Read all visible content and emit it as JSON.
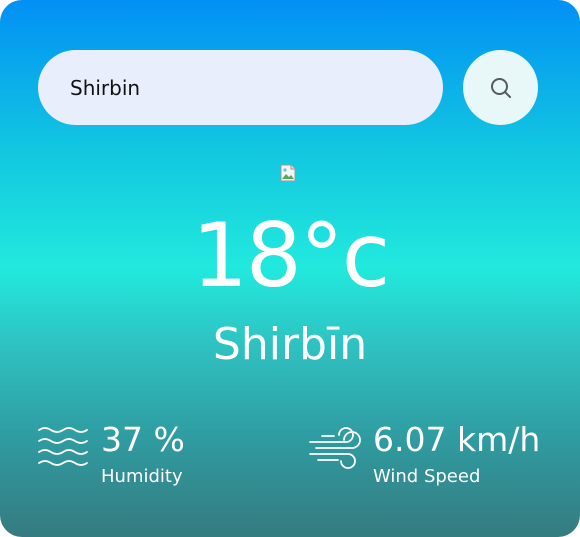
{
  "search": {
    "value": "Shirbin",
    "button_icon": "search-icon"
  },
  "weather": {
    "icon": "broken-image-icon",
    "temperature": "18°c",
    "city": "Shirbīn"
  },
  "details": {
    "humidity": {
      "icon": "waves-icon",
      "value": "37 %",
      "label": "Humidity"
    },
    "wind": {
      "icon": "wind-icon",
      "value": "6.07 km/h",
      "label": "Wind Speed"
    }
  },
  "colors": {
    "gradient_top": "#0290f5",
    "gradient_mid": "#22e9dd",
    "gradient_bottom": "#357b80",
    "input_bg": "#e8eefc",
    "button_bg": "#e8f7f7",
    "text": "#ffffff"
  }
}
